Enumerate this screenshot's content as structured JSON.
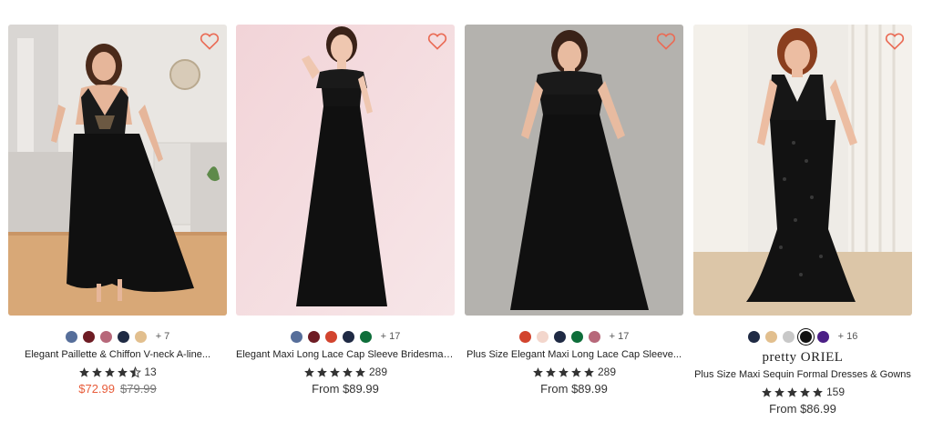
{
  "colors": {
    "heart": "#ea6b55",
    "star": "#333333",
    "sale_price": "#e85d3b",
    "dress": "#101010"
  },
  "products": [
    {
      "image_alt": "Model wearing black chiffon high-low dress",
      "favorite_icon": "heart-outline-icon",
      "swatches": [
        "#566e9a",
        "#6e1c24",
        "#b7687a",
        "#1f2a44",
        "#e2bf8e"
      ],
      "more_colors": "+ 7",
      "brand": "",
      "title": "Elegant Paillette & Chiffon V-neck A-line...",
      "rating": 4.5,
      "reviews": "13",
      "price": "$72.99",
      "original_price": "$79.99"
    },
    {
      "image_alt": "Model wearing black lace cap sleeve maxi dress",
      "favorite_icon": "heart-outline-icon",
      "swatches": [
        "#566e9a",
        "#6e1c24",
        "#d2442e",
        "#1f2a44",
        "#0e6e3a"
      ],
      "more_colors": "+ 17",
      "brand": "",
      "title": "Elegant Maxi Long Lace Cap Sleeve Bridesmaid...",
      "rating": 5,
      "reviews": "289",
      "price": "From $89.99",
      "original_price": ""
    },
    {
      "image_alt": "Plus size model wearing black lace cap sleeve maxi dress",
      "favorite_icon": "heart-outline-icon",
      "swatches": [
        "#d2442e",
        "#f3d6cc",
        "#1f2a44",
        "#0e6e3a",
        "#b7687a"
      ],
      "more_colors": "+ 17",
      "brand": "",
      "title": "Plus Size Elegant Maxi Long Lace Cap Sleeve...",
      "rating": 5,
      "reviews": "289",
      "price": "From $89.99",
      "original_price": ""
    },
    {
      "image_alt": "Plus size model wearing black sequin mermaid gown",
      "favorite_icon": "heart-outline-icon",
      "swatches": [
        "#1f2a44",
        "#e2bf8e",
        "#c8c8c8",
        "#111111",
        "#4b1f86"
      ],
      "selected_swatch": 3,
      "more_colors": "+ 16",
      "brand": "pretty ORIEL",
      "title": "Plus Size Maxi Sequin Formal Dresses & Gowns",
      "rating": 5,
      "reviews": "159",
      "price": "From $86.99",
      "original_price": ""
    }
  ]
}
